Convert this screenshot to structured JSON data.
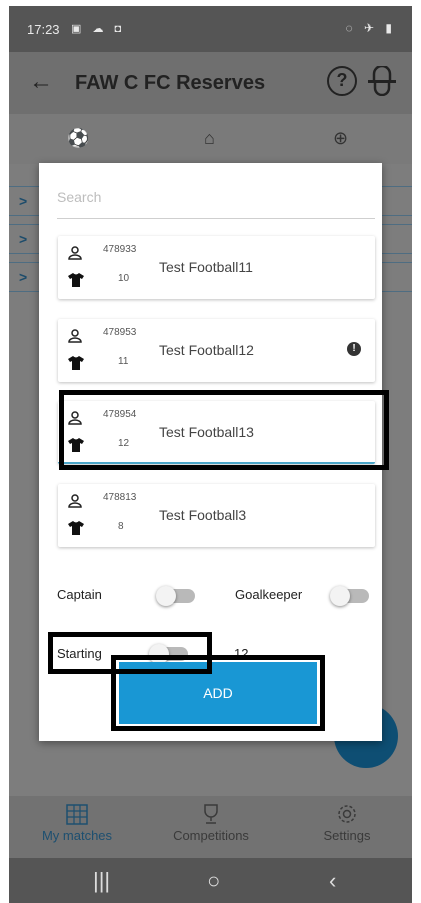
{
  "status": {
    "time": "17:23"
  },
  "appbar": {
    "title": "FAW C FC Reserves"
  },
  "dialog": {
    "search_placeholder": "Search",
    "players": [
      {
        "id": "478933",
        "number": "10",
        "name": "Test Football11",
        "warning": false
      },
      {
        "id": "478953",
        "number": "11",
        "name": "Test Football12",
        "warning": true
      },
      {
        "id": "478954",
        "number": "12",
        "name": "Test Football13",
        "warning": false,
        "selected": true
      },
      {
        "id": "478813",
        "number": "8",
        "name": "Test Football3",
        "warning": false
      }
    ],
    "captain_label": "Captain",
    "goalkeeper_label": "Goalkeeper",
    "starting_label": "Starting",
    "starting_count": "12",
    "add_label": "ADD"
  },
  "bottom_nav": {
    "items": [
      {
        "label": "My matches",
        "icon": "calendar-grid-icon",
        "active": true
      },
      {
        "label": "Competitions",
        "icon": "trophy-icon",
        "active": false
      },
      {
        "label": "Settings",
        "icon": "gear-icon",
        "active": false
      }
    ]
  },
  "colors": {
    "accent": "#1997d4",
    "nav_active": "#1d4f70",
    "highlight_border": "#000000"
  }
}
